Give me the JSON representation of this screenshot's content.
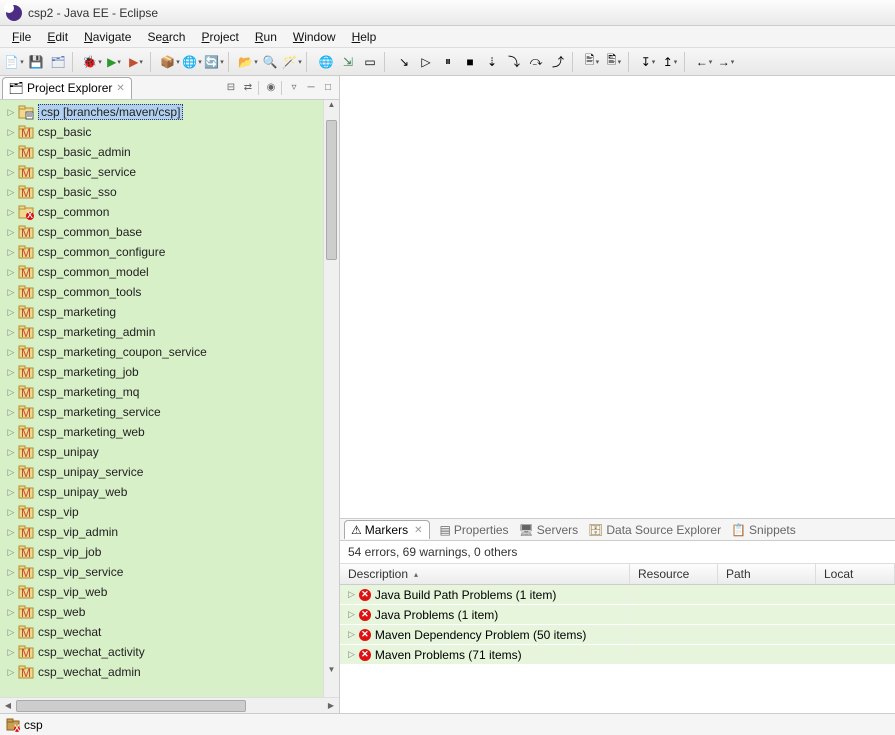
{
  "title": "csp2 - Java EE - Eclipse",
  "menu": [
    "File",
    "Edit",
    "Navigate",
    "Search",
    "Project",
    "Run",
    "Window",
    "Help"
  ],
  "project_explorer": {
    "label": "Project Explorer",
    "items": [
      {
        "name": "csp [branches/maven/csp]",
        "selected": true,
        "svn": true
      },
      {
        "name": "csp_basic"
      },
      {
        "name": "csp_basic_admin"
      },
      {
        "name": "csp_basic_service"
      },
      {
        "name": "csp_basic_sso"
      },
      {
        "name": "csp_common",
        "err": true
      },
      {
        "name": "csp_common_base"
      },
      {
        "name": "csp_common_configure"
      },
      {
        "name": "csp_common_model"
      },
      {
        "name": "csp_common_tools"
      },
      {
        "name": "csp_marketing"
      },
      {
        "name": "csp_marketing_admin"
      },
      {
        "name": "csp_marketing_coupon_service"
      },
      {
        "name": "csp_marketing_job"
      },
      {
        "name": "csp_marketing_mq"
      },
      {
        "name": "csp_marketing_service"
      },
      {
        "name": "csp_marketing_web"
      },
      {
        "name": "csp_unipay"
      },
      {
        "name": "csp_unipay_service"
      },
      {
        "name": "csp_unipay_web"
      },
      {
        "name": "csp_vip"
      },
      {
        "name": "csp_vip_admin"
      },
      {
        "name": "csp_vip_job"
      },
      {
        "name": "csp_vip_service"
      },
      {
        "name": "csp_vip_web"
      },
      {
        "name": "csp_web"
      },
      {
        "name": "csp_wechat"
      },
      {
        "name": "csp_wechat_activity"
      },
      {
        "name": "csp_wechat_admin"
      }
    ]
  },
  "bottom_tabs": [
    "Markers",
    "Properties",
    "Servers",
    "Data Source Explorer",
    "Snippets"
  ],
  "markers": {
    "summary": "54 errors, 69 warnings, 0 others",
    "columns": [
      "Description",
      "Resource",
      "Path",
      "Locat"
    ],
    "rows": [
      "Java Build Path Problems (1 item)",
      "Java Problems (1 item)",
      "Maven Dependency Problem (50 items)",
      "Maven Problems (71 items)"
    ]
  },
  "status": {
    "label": "csp"
  },
  "colors": {
    "tree_bg": "#d8f0c8",
    "row_bg": "#e6f5dc"
  }
}
